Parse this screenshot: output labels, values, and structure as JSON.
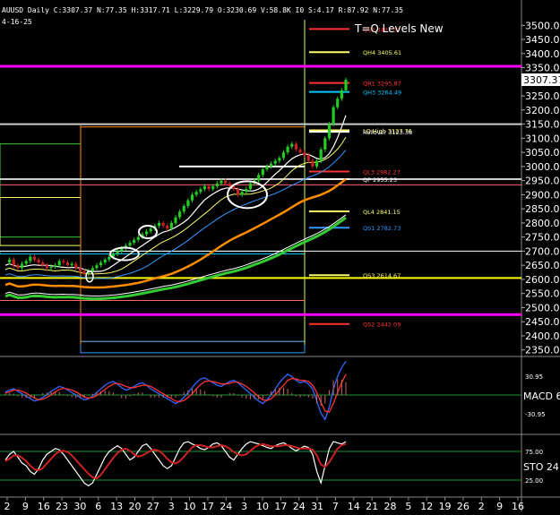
{
  "header": {
    "info": "AUUSD Daily C:3307.37 N:77.35 H:3317.71 L:3229.79 O:3230.69 V:58.8K I0 S:4.17 R:87.92 N:77.35",
    "date": "4-16-25"
  },
  "colors": {
    "background": "#000000",
    "up_candle": "#22cc22",
    "down_candle": "#cc2222",
    "magenta": "#ff00ff",
    "yellow": "#ffff00",
    "cyan": "#00c8ff",
    "orange": "#ff8c00",
    "green_ma": "#33cc33",
    "grid": "#333333"
  },
  "chart_data": [
    {
      "type": "line",
      "name": "price-panel",
      "title": "T=Q Levels New",
      "ylim": [
        2330,
        3520
      ],
      "y_ticks": [
        "3500.00",
        "3450.00",
        "3400.00",
        "3350.00",
        "3300.00",
        "3250.00",
        "3200.00",
        "3150.00",
        "3100.00",
        "3050.00",
        "3000.00",
        "2950.00",
        "2900.00",
        "2850.00",
        "2800.00",
        "2750.00",
        "2700.00",
        "2650.00",
        "2600.00",
        "2550.00",
        "2500.00",
        "2450.00",
        "2400.00",
        "2350.00"
      ],
      "last_price_label": "3307.37",
      "x_labels": [
        "2",
        "9",
        "16",
        "23",
        "30",
        "6",
        "13",
        "20",
        "27",
        "3",
        "10",
        "17",
        "24",
        "3",
        "10",
        "17",
        "24",
        "31",
        "7",
        "14",
        "21",
        "28",
        "5",
        "12",
        "19",
        "26",
        "2",
        "9",
        "16"
      ],
      "close_series": [
        2660,
        2670,
        2650,
        2640,
        2655,
        2665,
        2680,
        2670,
        2660,
        2650,
        2640,
        2645,
        2650,
        2665,
        2660,
        2650,
        2655,
        2640,
        2630,
        2620,
        2630,
        2640,
        2650,
        2660,
        2670,
        2680,
        2690,
        2700,
        2710,
        2720,
        2730,
        2740,
        2750,
        2760,
        2770,
        2780,
        2790,
        2800,
        2790,
        2780,
        2800,
        2820,
        2840,
        2860,
        2880,
        2900,
        2910,
        2920,
        2930,
        2920,
        2930,
        2940,
        2950,
        2940,
        2930,
        2920,
        2900,
        2910,
        2920,
        2940,
        2950,
        2970,
        2990,
        3000,
        3010,
        3020,
        3030,
        3050,
        3070,
        3080,
        3060,
        3050,
        3040,
        3020,
        3000,
        3020,
        3060,
        3100,
        3150,
        3210,
        3240,
        3270,
        3307
      ],
      "levels": [
        {
          "name": "QS2",
          "label": "QS2 3487.37",
          "value": 3487,
          "color": "#ff3333"
        },
        {
          "name": "QH4",
          "label": "QH4 3405.61",
          "value": 3405,
          "color": "#ffff66"
        },
        {
          "name": "QR1",
          "label": "QR1 3295.87",
          "value": 3296,
          "color": "#ff3333"
        },
        {
          "name": "QH3",
          "label": "QH3 3264.49",
          "value": 3264,
          "color": "#00c8ff"
        },
        {
          "name": "LQ-High",
          "label": "LQ High 3127.76",
          "value": 3128,
          "color": "#ffff66"
        },
        {
          "name": "Rollover",
          "label": "Rollover 3123.38",
          "value": 3123,
          "color": "#ffffff"
        },
        {
          "name": "QL3",
          "label": "QL3 2982.27",
          "value": 2982,
          "color": "#ff3333"
        },
        {
          "name": "QP",
          "label": "QP 2955.23",
          "value": 2955,
          "color": "#ffffff"
        },
        {
          "name": "QL4",
          "label": "QL4 2841.15",
          "value": 2841,
          "color": "#ffff66"
        },
        {
          "name": "QS1",
          "label": "QS1 2782.73",
          "value": 2783,
          "color": "#3399ff"
        },
        {
          "name": "QS3",
          "label": "QS3 2614.67",
          "value": 2615,
          "color": "#ffff66"
        },
        {
          "name": "QS2-low",
          "label": "QS2 2442.09",
          "value": 2442,
          "color": "#ff3333"
        }
      ]
    },
    {
      "type": "line",
      "name": "macd-panel",
      "label": "MACD 6",
      "y_ticks": [
        "30.95",
        "-30.95"
      ],
      "ylim": [
        -60,
        60
      ],
      "series": [
        {
          "values": [
            5,
            8,
            10,
            6,
            2,
            -2,
            -6,
            -10,
            -8,
            -4,
            0,
            6,
            10,
            14,
            12,
            8,
            4,
            0,
            -4,
            -8,
            -6,
            -2,
            4,
            10,
            16,
            20,
            22,
            18,
            12,
            8,
            10,
            14,
            18,
            20,
            16,
            10,
            6,
            2,
            -2,
            -6,
            -10,
            -14,
            -10,
            -4,
            4,
            12,
            20,
            26,
            28,
            24,
            20,
            16,
            14,
            18,
            22,
            24,
            20,
            14,
            8,
            2,
            -4,
            -10,
            -14,
            -8,
            0,
            10,
            20,
            28,
            34,
            30,
            24,
            20,
            22,
            18,
            10,
            -10,
            -30,
            -40,
            -20,
            10,
            30,
            45,
            55
          ]
        },
        {
          "values": [
            3,
            5,
            8,
            8,
            6,
            3,
            -1,
            -5,
            -8,
            -7,
            -4,
            0,
            5,
            9,
            11,
            10,
            8,
            5,
            1,
            -3,
            -5,
            -4,
            -1,
            4,
            9,
            14,
            18,
            19,
            17,
            14,
            12,
            12,
            14,
            16,
            16,
            14,
            10,
            6,
            2,
            -2,
            -6,
            -10,
            -11,
            -9,
            -4,
            2,
            10,
            17,
            22,
            23,
            22,
            20,
            18,
            18,
            19,
            21,
            21,
            18,
            14,
            9,
            3,
            -3,
            -8,
            -9,
            -6,
            0,
            8,
            16,
            24,
            27,
            26,
            24,
            24,
            22,
            16,
            4,
            -12,
            -26,
            -28,
            -14,
            4,
            20,
            34
          ]
        }
      ]
    },
    {
      "type": "line",
      "name": "stochastic-panel",
      "label": "STO 24",
      "y_ticks": [
        "75.00",
        "25.00"
      ],
      "ylim": [
        0,
        100
      ],
      "series": [
        {
          "values": [
            60,
            70,
            75,
            65,
            55,
            50,
            40,
            35,
            45,
            60,
            70,
            75,
            80,
            78,
            70,
            60,
            50,
            40,
            30,
            20,
            15,
            20,
            35,
            50,
            65,
            75,
            80,
            85,
            80,
            70,
            60,
            65,
            75,
            85,
            88,
            80,
            70,
            60,
            50,
            45,
            50,
            65,
            80,
            90,
            92,
            88,
            85,
            80,
            78,
            82,
            88,
            90,
            85,
            75,
            65,
            60,
            70,
            80,
            88,
            92,
            90,
            88,
            85,
            82,
            80,
            85,
            88,
            90,
            86,
            80,
            76,
            80,
            84,
            82,
            70,
            40,
            20,
            50,
            80,
            92,
            90,
            88,
            92
          ]
        },
        {
          "values": [
            58,
            62,
            68,
            68,
            64,
            58,
            50,
            44,
            42,
            46,
            54,
            62,
            70,
            75,
            76,
            74,
            68,
            60,
            52,
            44,
            36,
            30,
            28,
            34,
            44,
            54,
            64,
            72,
            78,
            80,
            76,
            70,
            66,
            68,
            72,
            76,
            78,
            76,
            70,
            62,
            56,
            54,
            58,
            66,
            74,
            82,
            86,
            86,
            84,
            82,
            82,
            84,
            86,
            84,
            80,
            74,
            70,
            68,
            70,
            76,
            82,
            86,
            88,
            86,
            84,
            84,
            84,
            86,
            86,
            84,
            82,
            80,
            80,
            80,
            78,
            68,
            52,
            48,
            56,
            68,
            80,
            86,
            88
          ]
        }
      ]
    }
  ]
}
